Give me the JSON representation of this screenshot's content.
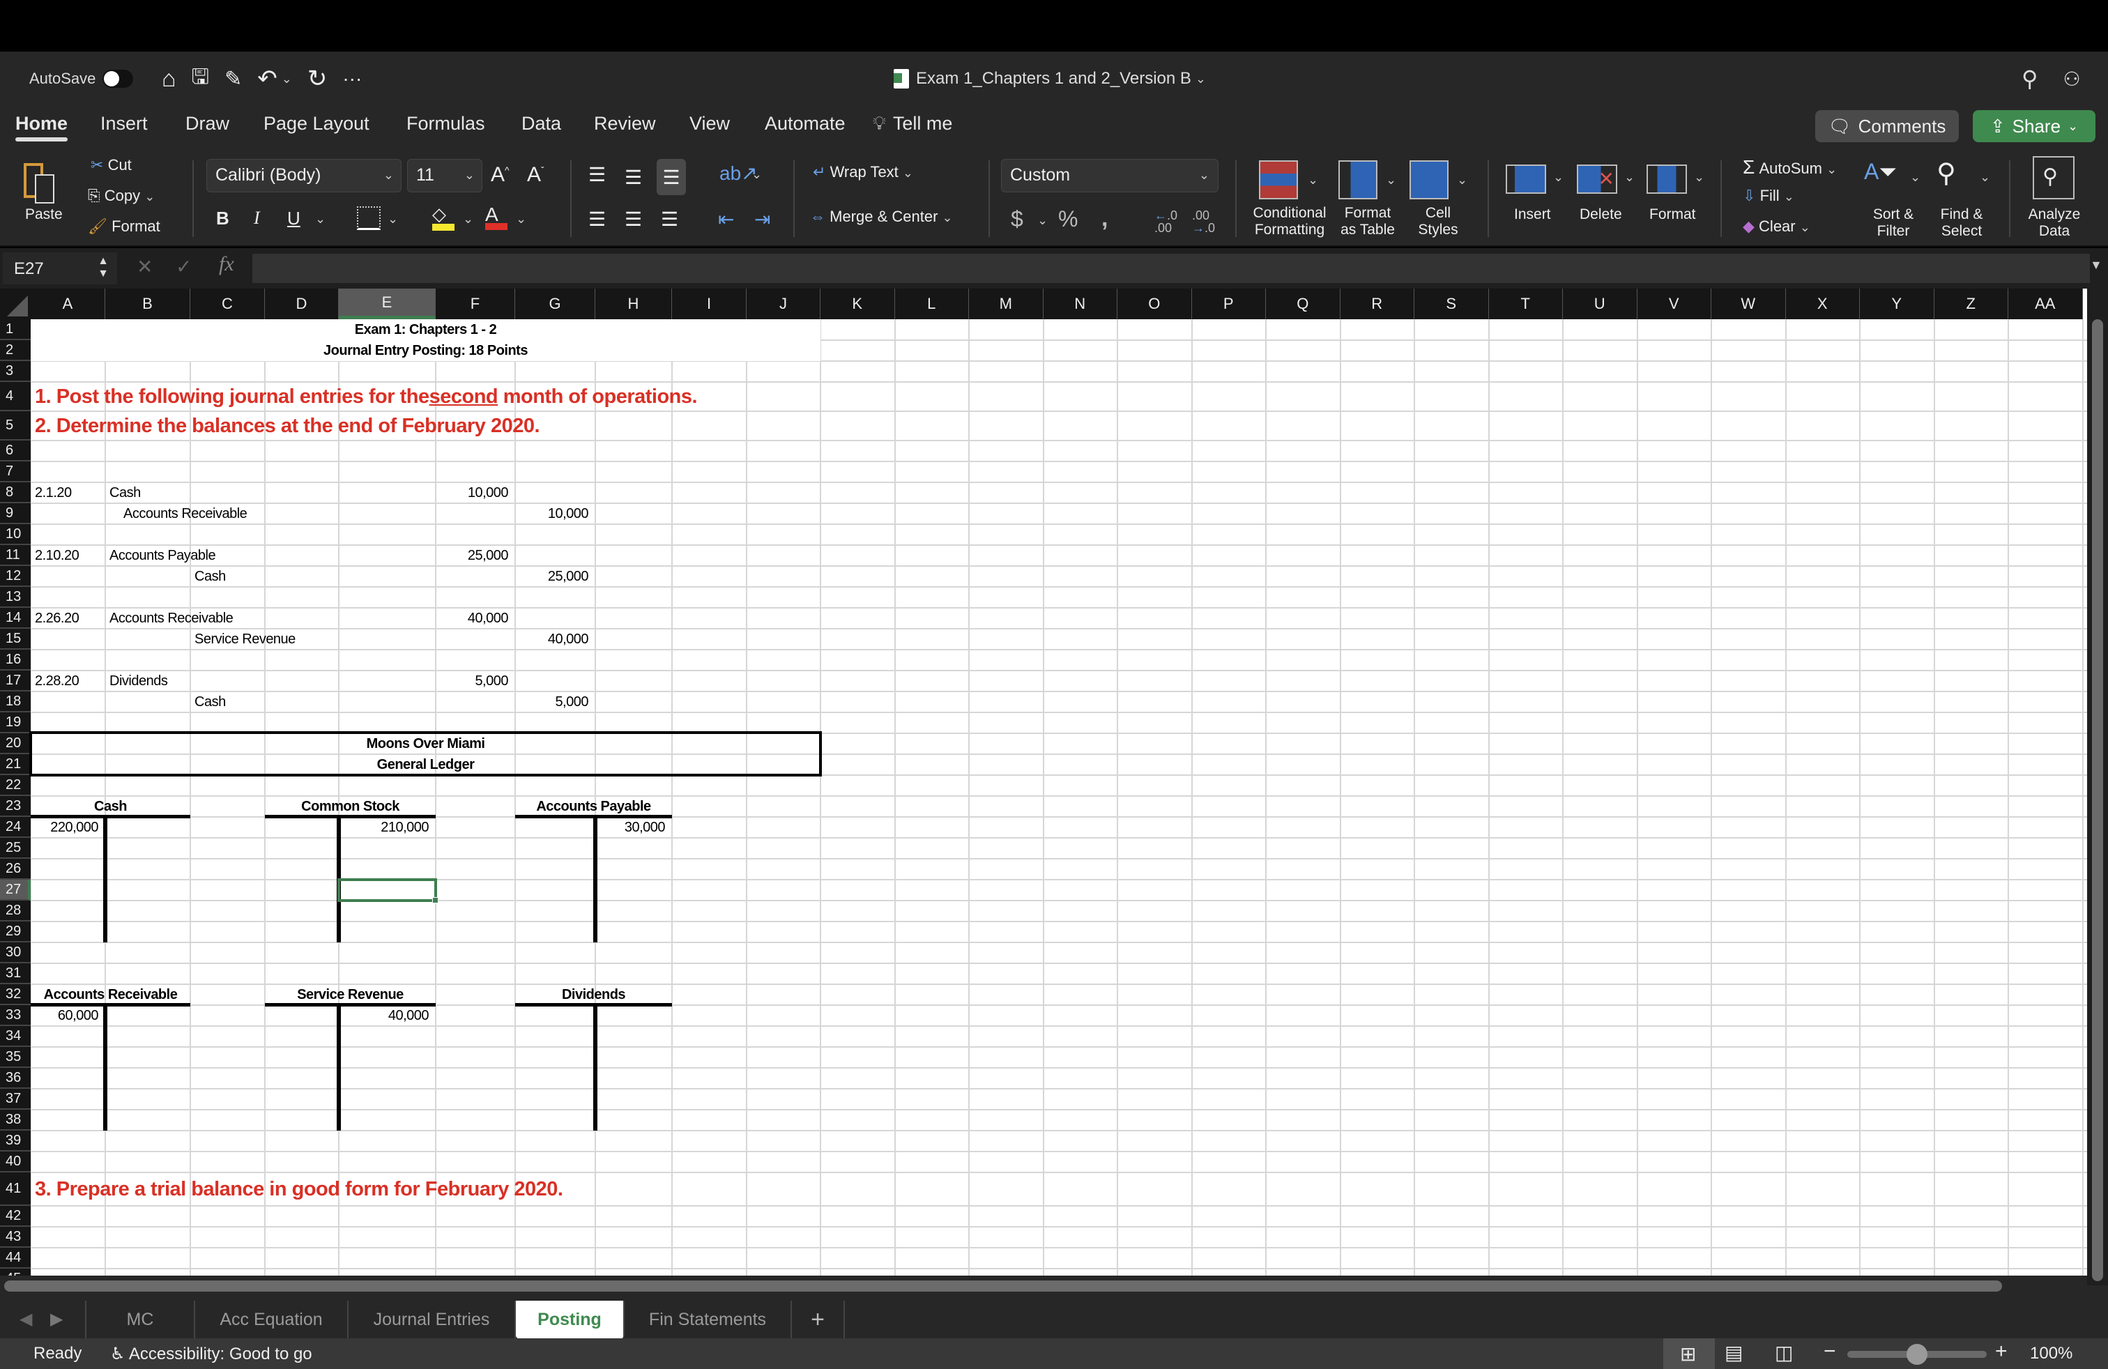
{
  "window": {
    "autosave_label": "AutoSave",
    "autosave_state": "off",
    "file_title": "Exam 1_Chapters 1 and 2_Version B",
    "quick_access": [
      "home-icon",
      "save-icon",
      "save-as-icon",
      "undo-icon",
      "redo-icon",
      "more-icon"
    ]
  },
  "ribbon_tabs": [
    "Home",
    "Insert",
    "Draw",
    "Page Layout",
    "Formulas",
    "Data",
    "Review",
    "View",
    "Automate"
  ],
  "active_tab": "Home",
  "tell_me": "Tell me",
  "comments_label": "Comments",
  "share_label": "Share",
  "clipboard": {
    "paste": "Paste",
    "cut": "Cut",
    "copy": "Copy",
    "format": "Format"
  },
  "font": {
    "name": "Calibri (Body)",
    "size": "11",
    "bold": "B",
    "italic": "I",
    "underline": "U",
    "fill_color": "#f5e72f",
    "font_color": "#e0302a"
  },
  "alignment": {
    "wrap_text": "Wrap Text",
    "merge_center": "Merge & Center"
  },
  "number": {
    "format": "Custom",
    "currency": "$",
    "percent": "%",
    "comma": "9"
  },
  "styles": {
    "conditional": [
      "Conditional",
      "Formatting"
    ],
    "format_table": [
      "Format",
      "as Table"
    ],
    "cell_styles": [
      "Cell",
      "Styles"
    ]
  },
  "cells_group": {
    "insert": "Insert",
    "delete": "Delete",
    "format": "Format"
  },
  "editing": {
    "autosum": "AutoSum",
    "fill": "Fill",
    "clear": "Clear",
    "sort": [
      "Sort &",
      "Filter"
    ],
    "find": [
      "Find &",
      "Select"
    ]
  },
  "analyze": [
    "Analyze",
    "Data"
  ],
  "formula_bar": {
    "name_box": "E27",
    "formula": "",
    "fx": "fx"
  },
  "columns": [
    "A",
    "B",
    "C",
    "D",
    "E",
    "F",
    "G",
    "H",
    "I",
    "J",
    "K",
    "L",
    "M",
    "N",
    "O",
    "P",
    "Q",
    "R",
    "S",
    "T",
    "U",
    "V",
    "W",
    "X",
    "Y",
    "Z",
    "AA"
  ],
  "selected_cell": {
    "col": "E",
    "row": 27
  },
  "sheet": {
    "title1": "Exam 1:  Chapters 1 - 2",
    "title2": "Journal Entry Posting:  18 Points",
    "instr1_pre": "1.  Post the following journal entries for the ",
    "instr1_u": "second",
    "instr1_post": " month of operations.",
    "instr2": "2.  Determine the balances at the end of February 2020.",
    "instr3": "3.  Prepare a trial balance in good form for February 2020.",
    "journal": [
      {
        "row": 8,
        "date": "2.1.20",
        "account": "Cash",
        "indent": false,
        "debit": "10,000",
        "credit": ""
      },
      {
        "row": 9,
        "date": "",
        "account": "Accounts Receivable",
        "indent": "small",
        "debit": "",
        "credit": "10,000"
      },
      {
        "row": 11,
        "date": "2.10.20",
        "account": "Accounts Payable",
        "indent": false,
        "debit": "25,000",
        "credit": ""
      },
      {
        "row": 12,
        "date": "",
        "account": "Cash",
        "indent": true,
        "debit": "",
        "credit": "25,000"
      },
      {
        "row": 14,
        "date": "2.26.20",
        "account": "Accounts Receivable",
        "indent": false,
        "debit": "40,000",
        "credit": ""
      },
      {
        "row": 15,
        "date": "",
        "account": "Service Revenue",
        "indent": true,
        "debit": "",
        "credit": "40,000"
      },
      {
        "row": 17,
        "date": "2.28.20",
        "account": "Dividends",
        "indent": false,
        "debit": "5,000",
        "credit": ""
      },
      {
        "row": 18,
        "date": "",
        "account": "Cash",
        "indent": true,
        "debit": "",
        "credit": "5,000"
      }
    ],
    "ledger_company": "Moons Over Miami",
    "ledger_title": "General Ledger",
    "t_accounts": [
      {
        "name": "Cash",
        "debit": "220,000",
        "credit": ""
      },
      {
        "name": "Common Stock",
        "debit": "",
        "credit": "210,000"
      },
      {
        "name": "Accounts Payable",
        "debit": "",
        "credit": "30,000"
      },
      {
        "name": "Accounts Receivable",
        "debit": "60,000",
        "credit": ""
      },
      {
        "name": "Service Revenue",
        "debit": "",
        "credit": "40,000"
      },
      {
        "name": "Dividends",
        "debit": "",
        "credit": ""
      }
    ]
  },
  "sheet_tabs": [
    "MC",
    "Acc Equation",
    "Journal Entries",
    "Posting",
    "Fin Statements"
  ],
  "active_sheet": "Posting",
  "status": {
    "ready": "Ready",
    "accessibility": "Accessibility: Good to go",
    "zoom": "100%",
    "zoom_fraction": 0.5
  },
  "colors": {
    "accent_green": "#3f8a4f",
    "instruction_red": "#d93025"
  }
}
